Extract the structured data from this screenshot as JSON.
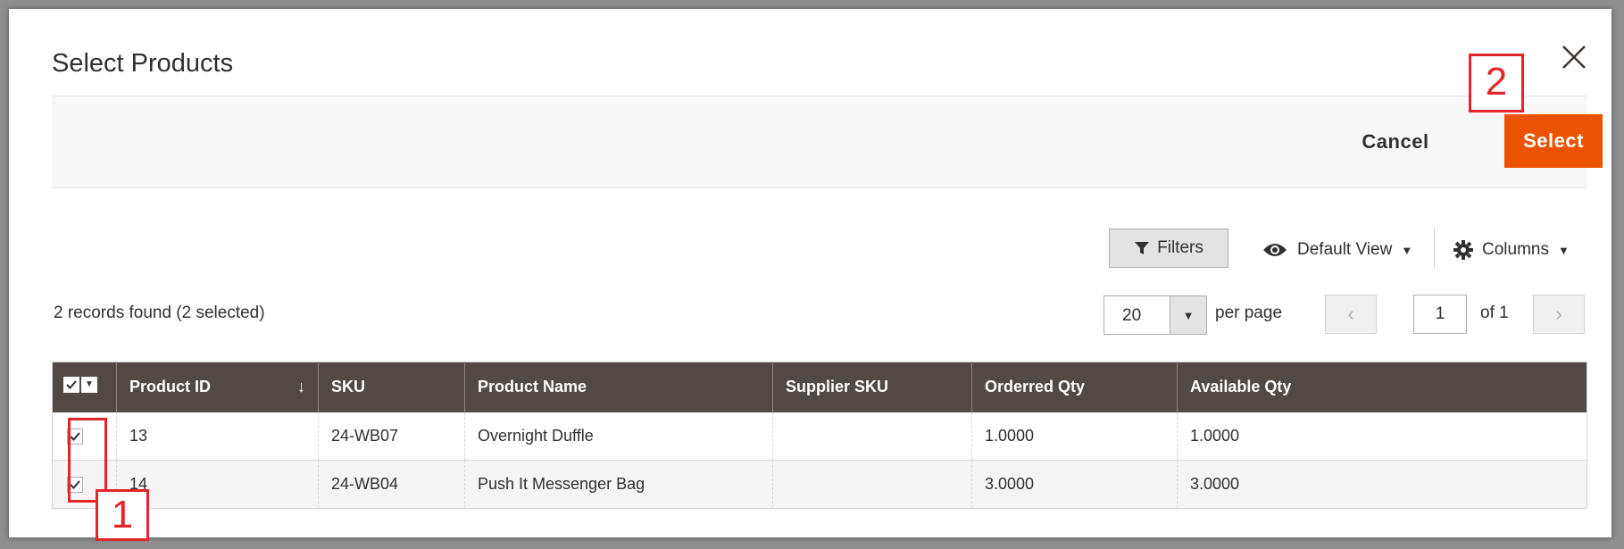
{
  "modal": {
    "title": "Select Products"
  },
  "toolbar": {
    "cancel_label": "Cancel",
    "select_label": "Select"
  },
  "controls": {
    "filters_label": "Filters",
    "view_label": "Default View",
    "columns_label": "Columns"
  },
  "summary": {
    "records_text": "2 records found (2 selected)"
  },
  "pagination": {
    "per_page_value": "20",
    "per_page_label": "per page",
    "current_page": "1",
    "of_label": "of 1"
  },
  "table": {
    "headers": [
      "Product ID",
      "SKU",
      "Product Name",
      "Supplier SKU",
      "Orderred Qty",
      "Available Qty"
    ],
    "rows": [
      {
        "checked": true,
        "product_id": "13",
        "sku": "24-WB07",
        "name": "Overnight Duffle",
        "supplier_sku": "",
        "ordered_qty": "1.0000",
        "available_qty": "1.0000"
      },
      {
        "checked": true,
        "product_id": "14",
        "sku": "24-WB04",
        "name": "Push It Messenger Bag",
        "supplier_sku": "",
        "ordered_qty": "3.0000",
        "available_qty": "3.0000"
      }
    ]
  },
  "annotations": {
    "step1": "1",
    "step2": "2",
    "color": "#e2252b"
  },
  "colors": {
    "primary_button": "#eb5202",
    "table_header": "#514943"
  },
  "icons": {
    "close": "close-icon",
    "filter": "funnel-icon",
    "view": "eye-icon",
    "columns": "gear-icon",
    "checkbox": "checkmark-icon"
  }
}
